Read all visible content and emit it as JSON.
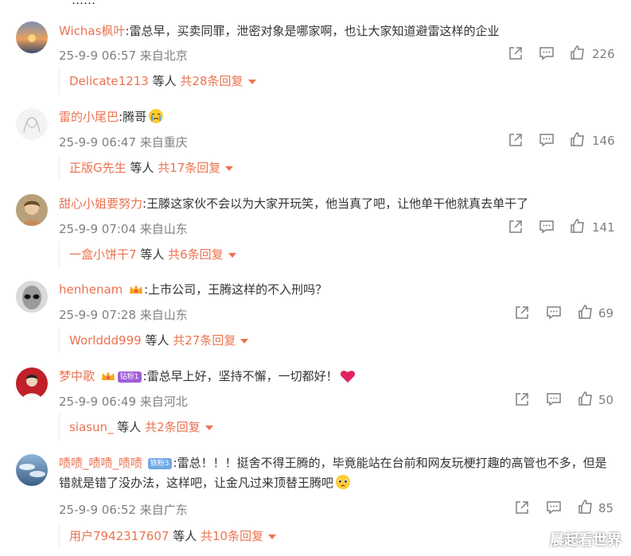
{
  "top_partial_text": "……",
  "comments": [
    {
      "username": "Wichas枫叶",
      "text": ":雷总早，买卖同罪，泄密对象是哪家啊，也让大家知道避雷这样的企业",
      "time": "25-9-9 06:57",
      "location": "来自北京",
      "likes": "226",
      "reply_user": "Delicate1213",
      "reply_mid": "等人",
      "reply_count": "共28条回复"
    },
    {
      "username": "雷的小尾巴",
      "text": ":腾哥",
      "emoji": "crying-face-emoji",
      "time": "25-9-9 06:47",
      "location": "来自重庆",
      "likes": "146",
      "reply_user": "正版G先生",
      "reply_mid": "等人",
      "reply_count": "共17条回复"
    },
    {
      "username": "甜心小姐要努力",
      "text": ":王滕这家伙不会以为大家开玩笑，他当真了吧，让他单干他就真去单干了",
      "time": "25-9-9 07:04",
      "location": "来自山东",
      "likes": "141",
      "reply_user": "一盒小饼干7",
      "reply_mid": "等人",
      "reply_count": "共6条回复"
    },
    {
      "username": "henhenam",
      "text": ":上市公司，王腾这样的不入刑吗？",
      "badge_icon": "crown-badge-icon",
      "time": "25-9-9 07:28",
      "location": "来自山东",
      "likes": "69",
      "reply_user": "Worlddd999",
      "reply_mid": "等人",
      "reply_count": "共27条回复"
    },
    {
      "username": "梦中歌",
      "text": ":雷总早上好，坚持不懈，一切都好！",
      "badge_icon": "crown-badge-icon",
      "badge_text": "钻粉1",
      "emoji": "red-heart-emoji",
      "time": "25-9-9 06:49",
      "location": "来自河北",
      "likes": "50",
      "reply_user": "siasun_",
      "reply_mid": "等人",
      "reply_count": "共2条回复"
    },
    {
      "username": "啧啧_啧啧_啧啧",
      "text": ":雷总！！！挺舍不得王腾的，毕竟能站在台前和网友玩梗打趣的高管也不多，但是错就是错了没办法，这样吧，让金凡过来顶替王腾吧",
      "badge_text": "铁粉3",
      "emoji": "pleading-face-emoji",
      "time": "25-9-9 06:52",
      "location": "来自广东",
      "likes": "85",
      "reply_user": "用户7942317607",
      "reply_mid": "等人",
      "reply_count": "共10条回复"
    }
  ],
  "watermark": "晨起看世界",
  "colors": {
    "username": "#eb7350",
    "meta": "#808080",
    "text": "#333333"
  }
}
